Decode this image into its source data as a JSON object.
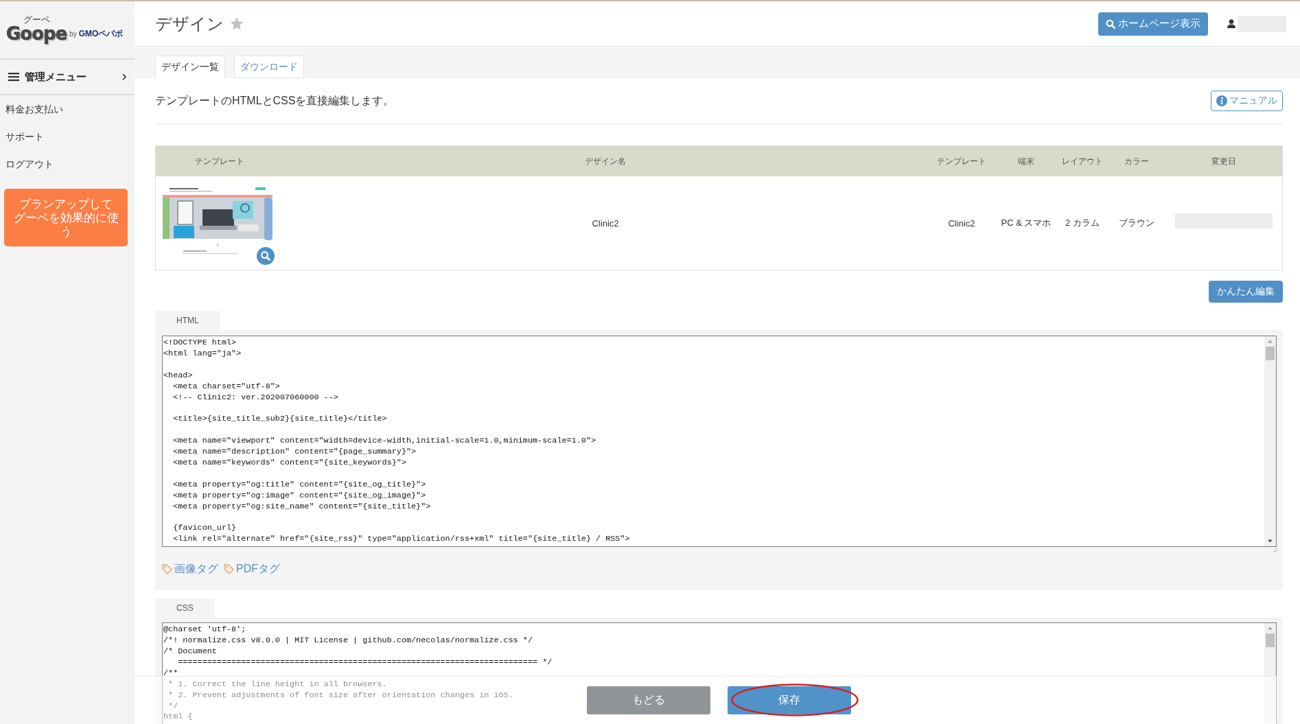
{
  "logo": {
    "ruby": "グーペ",
    "wordmark": "Goope",
    "byline": "by **GMOペパボ**"
  },
  "sidebar": {
    "menu_label": "管理メニュー",
    "items": [
      "料金お支払い",
      "サポート",
      "ログアウト"
    ],
    "promo_button": "プランアップしてグーペを効果的に使う"
  },
  "header": {
    "title": "デザイン",
    "starred": false,
    "homepage_button": "ホームページ表示"
  },
  "tabs": [
    {
      "label": "デザイン一覧",
      "selected": true
    },
    {
      "label": "ダウンロード",
      "selected": false
    }
  ],
  "description": "テンプレートのHTMLとCSSを直接編集します。",
  "manual_button": "マニュアル",
  "table": {
    "columns": [
      "テンプレート",
      "デザイン名",
      "テンプレート",
      "端末",
      "レイアウト",
      "カラー",
      "変更日"
    ],
    "rows": [
      {
        "design_name": "Clinic2",
        "template": "Clinic2",
        "device": "PC & スマホ",
        "layout": "2 カラム",
        "color_scheme": "ブラウン"
      }
    ]
  },
  "easy_edit_button": "かんたん編集",
  "editors": [
    {
      "label": "HTML",
      "code": "<!DOCTYPE html>\n<html lang=\"ja\">\n\n<head>\n  <meta charset=\"utf-8\">\n  <!-- Clinic2: ver.202007060000 -->\n\n  <title>{site_title_sub2}{site_title}</title>\n\n  <meta name=\"viewport\" content=\"width=device-width,initial-scale=1.0,minimum-scale=1.0\">\n  <meta name=\"description\" content=\"{page_summary}\">\n  <meta name=\"keywords\" content=\"{site_keywords}\">\n\n  <meta property=\"og:title\" content=\"{site_og_title}\">\n  <meta property=\"og:image\" content=\"{site_og_image}\">\n  <meta property=\"og:site_name\" content=\"{site_title}\">\n\n  {favicon_url}\n  <link rel=\"alternate\" href=\"{site_rss}\" type=\"application/rss+xml\" title=\"{site_title} / RSS\">",
      "tag_links": [
        "画像タグ",
        "PDFタグ"
      ]
    },
    {
      "label": "CSS",
      "code": "@charset 'utf-8';\n/*! normalize.css v8.0.0 | MIT License | github.com/necolas/normalize.css */\n/* Document\n   ========================================================================== */\n/**\n * 1. Correct the line height in all browsers.\n * 2. Prevent adjustments of font size after orientation changes in iOS.\n */\nhtml {"
    }
  ],
  "actions": [
    {
      "label": "もどる",
      "kind": "secondary",
      "annotated": false
    },
    {
      "label": "保存",
      "kind": "primary",
      "annotated": true
    }
  ]
}
